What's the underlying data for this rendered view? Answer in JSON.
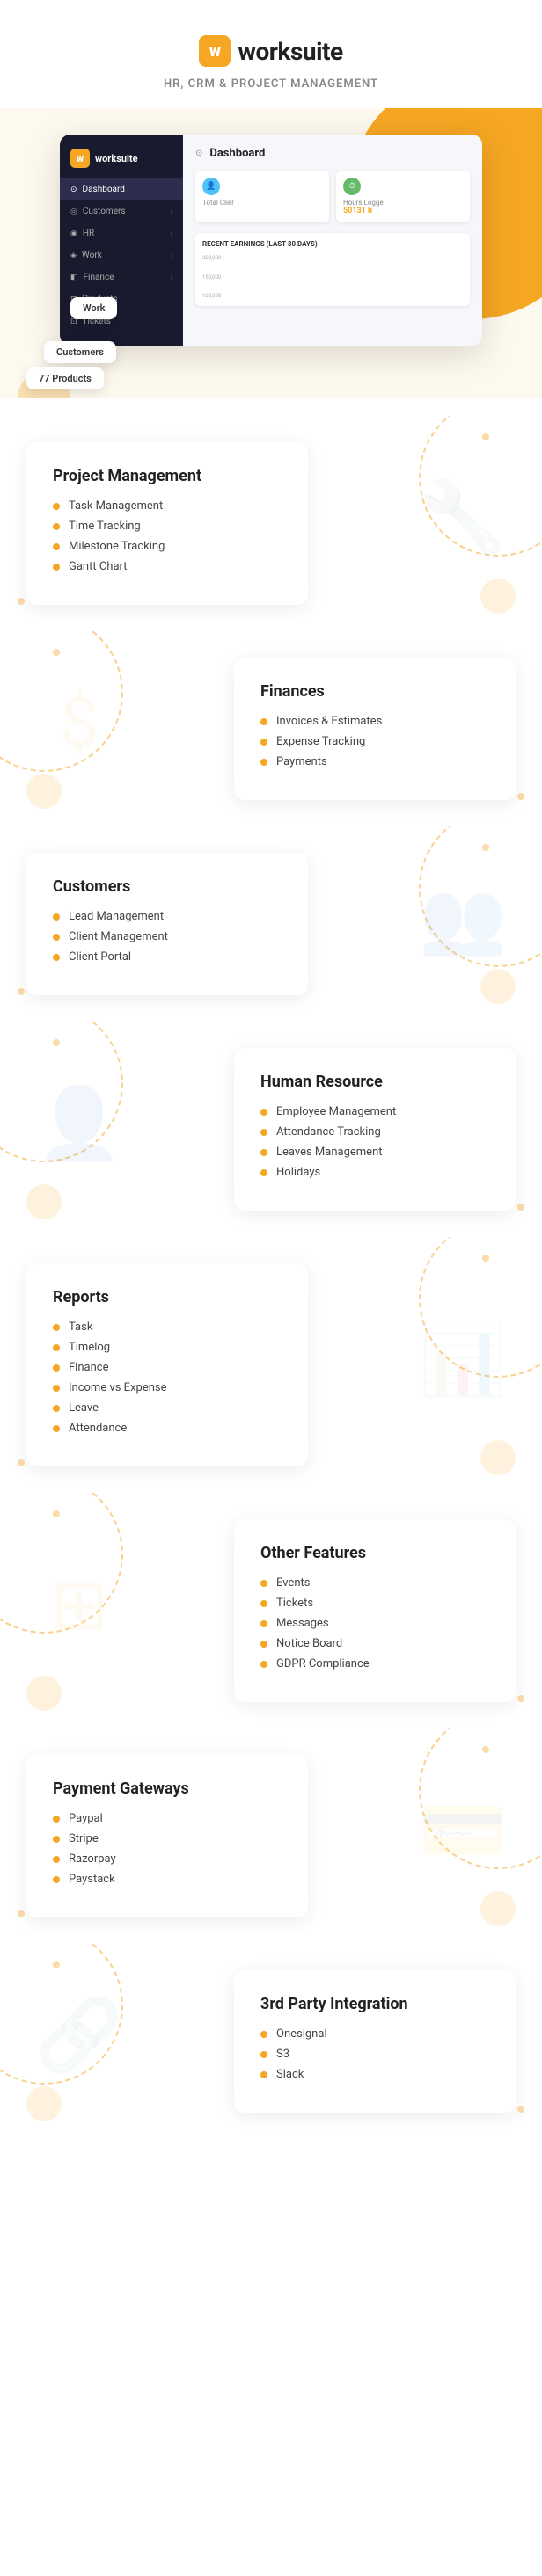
{
  "header": {
    "logo_letter": "w",
    "logo_name": "worksuite",
    "subtitle": "HR, CRM & PROJECT MANAGEMENT"
  },
  "dashboard_mockup": {
    "sidebar": {
      "logo_letter": "w",
      "logo_name": "worksuite",
      "nav_items": [
        {
          "label": "Dashboard",
          "active": true,
          "icon": "⊙"
        },
        {
          "label": "Customers",
          "active": false,
          "icon": "◎",
          "arrow": true
        },
        {
          "label": "HR",
          "active": false,
          "icon": "◉",
          "arrow": true
        },
        {
          "label": "Work",
          "active": false,
          "icon": "◈",
          "arrow": true
        },
        {
          "label": "Finance",
          "active": false,
          "icon": "◧",
          "arrow": true
        },
        {
          "label": "Products",
          "active": false,
          "icon": "⊞"
        },
        {
          "label": "Tickets",
          "active": false,
          "icon": "⊡"
        }
      ]
    },
    "content": {
      "title": "Dashboard",
      "stats": [
        {
          "icon": "👤",
          "icon_bg": "#4fc3f7",
          "label": "Total Clier",
          "value": ""
        },
        {
          "icon": "⏱",
          "icon_bg": "#66bb6a",
          "label": "Hours Logge",
          "value": "50131 h"
        }
      ],
      "chart": {
        "title": "RECENT EARNINGS (LAST 30 DAYS)",
        "y_labels": [
          "200,000",
          "150,000",
          "100,000"
        ],
        "bars": [
          {
            "height": 30,
            "color": "#e0e0e0"
          },
          {
            "height": 45,
            "color": "#e0e0e0"
          },
          {
            "height": 20,
            "color": "#e0e0e0"
          },
          {
            "height": 50,
            "color": "#4fc8e8"
          },
          {
            "height": 35,
            "color": "#e0e0e0"
          }
        ]
      }
    }
  },
  "sections": [
    {
      "id": "project-management",
      "title": "Project Management",
      "align": "left",
      "items": [
        "Task Management",
        "Time Tracking",
        "Milestone Tracking",
        "Gantt Chart"
      ],
      "deco_icon": "🔧"
    },
    {
      "id": "finances",
      "title": "Finances",
      "align": "right",
      "items": [
        "Invoices & Estimates",
        "Expense Tracking",
        "Payments"
      ],
      "deco_icon": "$"
    },
    {
      "id": "customers",
      "title": "Customers",
      "align": "left",
      "items": [
        "Lead Management",
        "Client Management",
        "Client Portal"
      ],
      "deco_icon": "👥"
    },
    {
      "id": "human-resource",
      "title": "Human Resource",
      "align": "right",
      "items": [
        "Employee Management",
        "Attendance Tracking",
        "Leaves Management",
        "Holidays"
      ],
      "deco_icon": "👤"
    },
    {
      "id": "reports",
      "title": "Reports",
      "align": "left",
      "items": [
        "Task",
        "Timelog",
        "Finance",
        "Income vs Expense",
        "Leave",
        "Attendance"
      ],
      "deco_icon": "📊"
    },
    {
      "id": "other-features",
      "title": "Other Features",
      "align": "right",
      "items": [
        "Events",
        "Tickets",
        "Messages",
        "Notice Board",
        "GDPR Compliance"
      ],
      "deco_icon": "⊞"
    },
    {
      "id": "payment-gateways",
      "title": "Payment Gateways",
      "align": "left",
      "items": [
        "Paypal",
        "Stripe",
        "Razorpay",
        "Paystack"
      ],
      "deco_icon": "💳"
    },
    {
      "id": "third-party",
      "title": "3rd Party Integration",
      "align": "right",
      "items": [
        "Onesignal",
        "S3",
        "Slack"
      ],
      "deco_icon": "🔗"
    }
  ],
  "colors": {
    "accent": "#f5a623",
    "bullet": "#f5a623",
    "dark": "#1a1a2e"
  }
}
